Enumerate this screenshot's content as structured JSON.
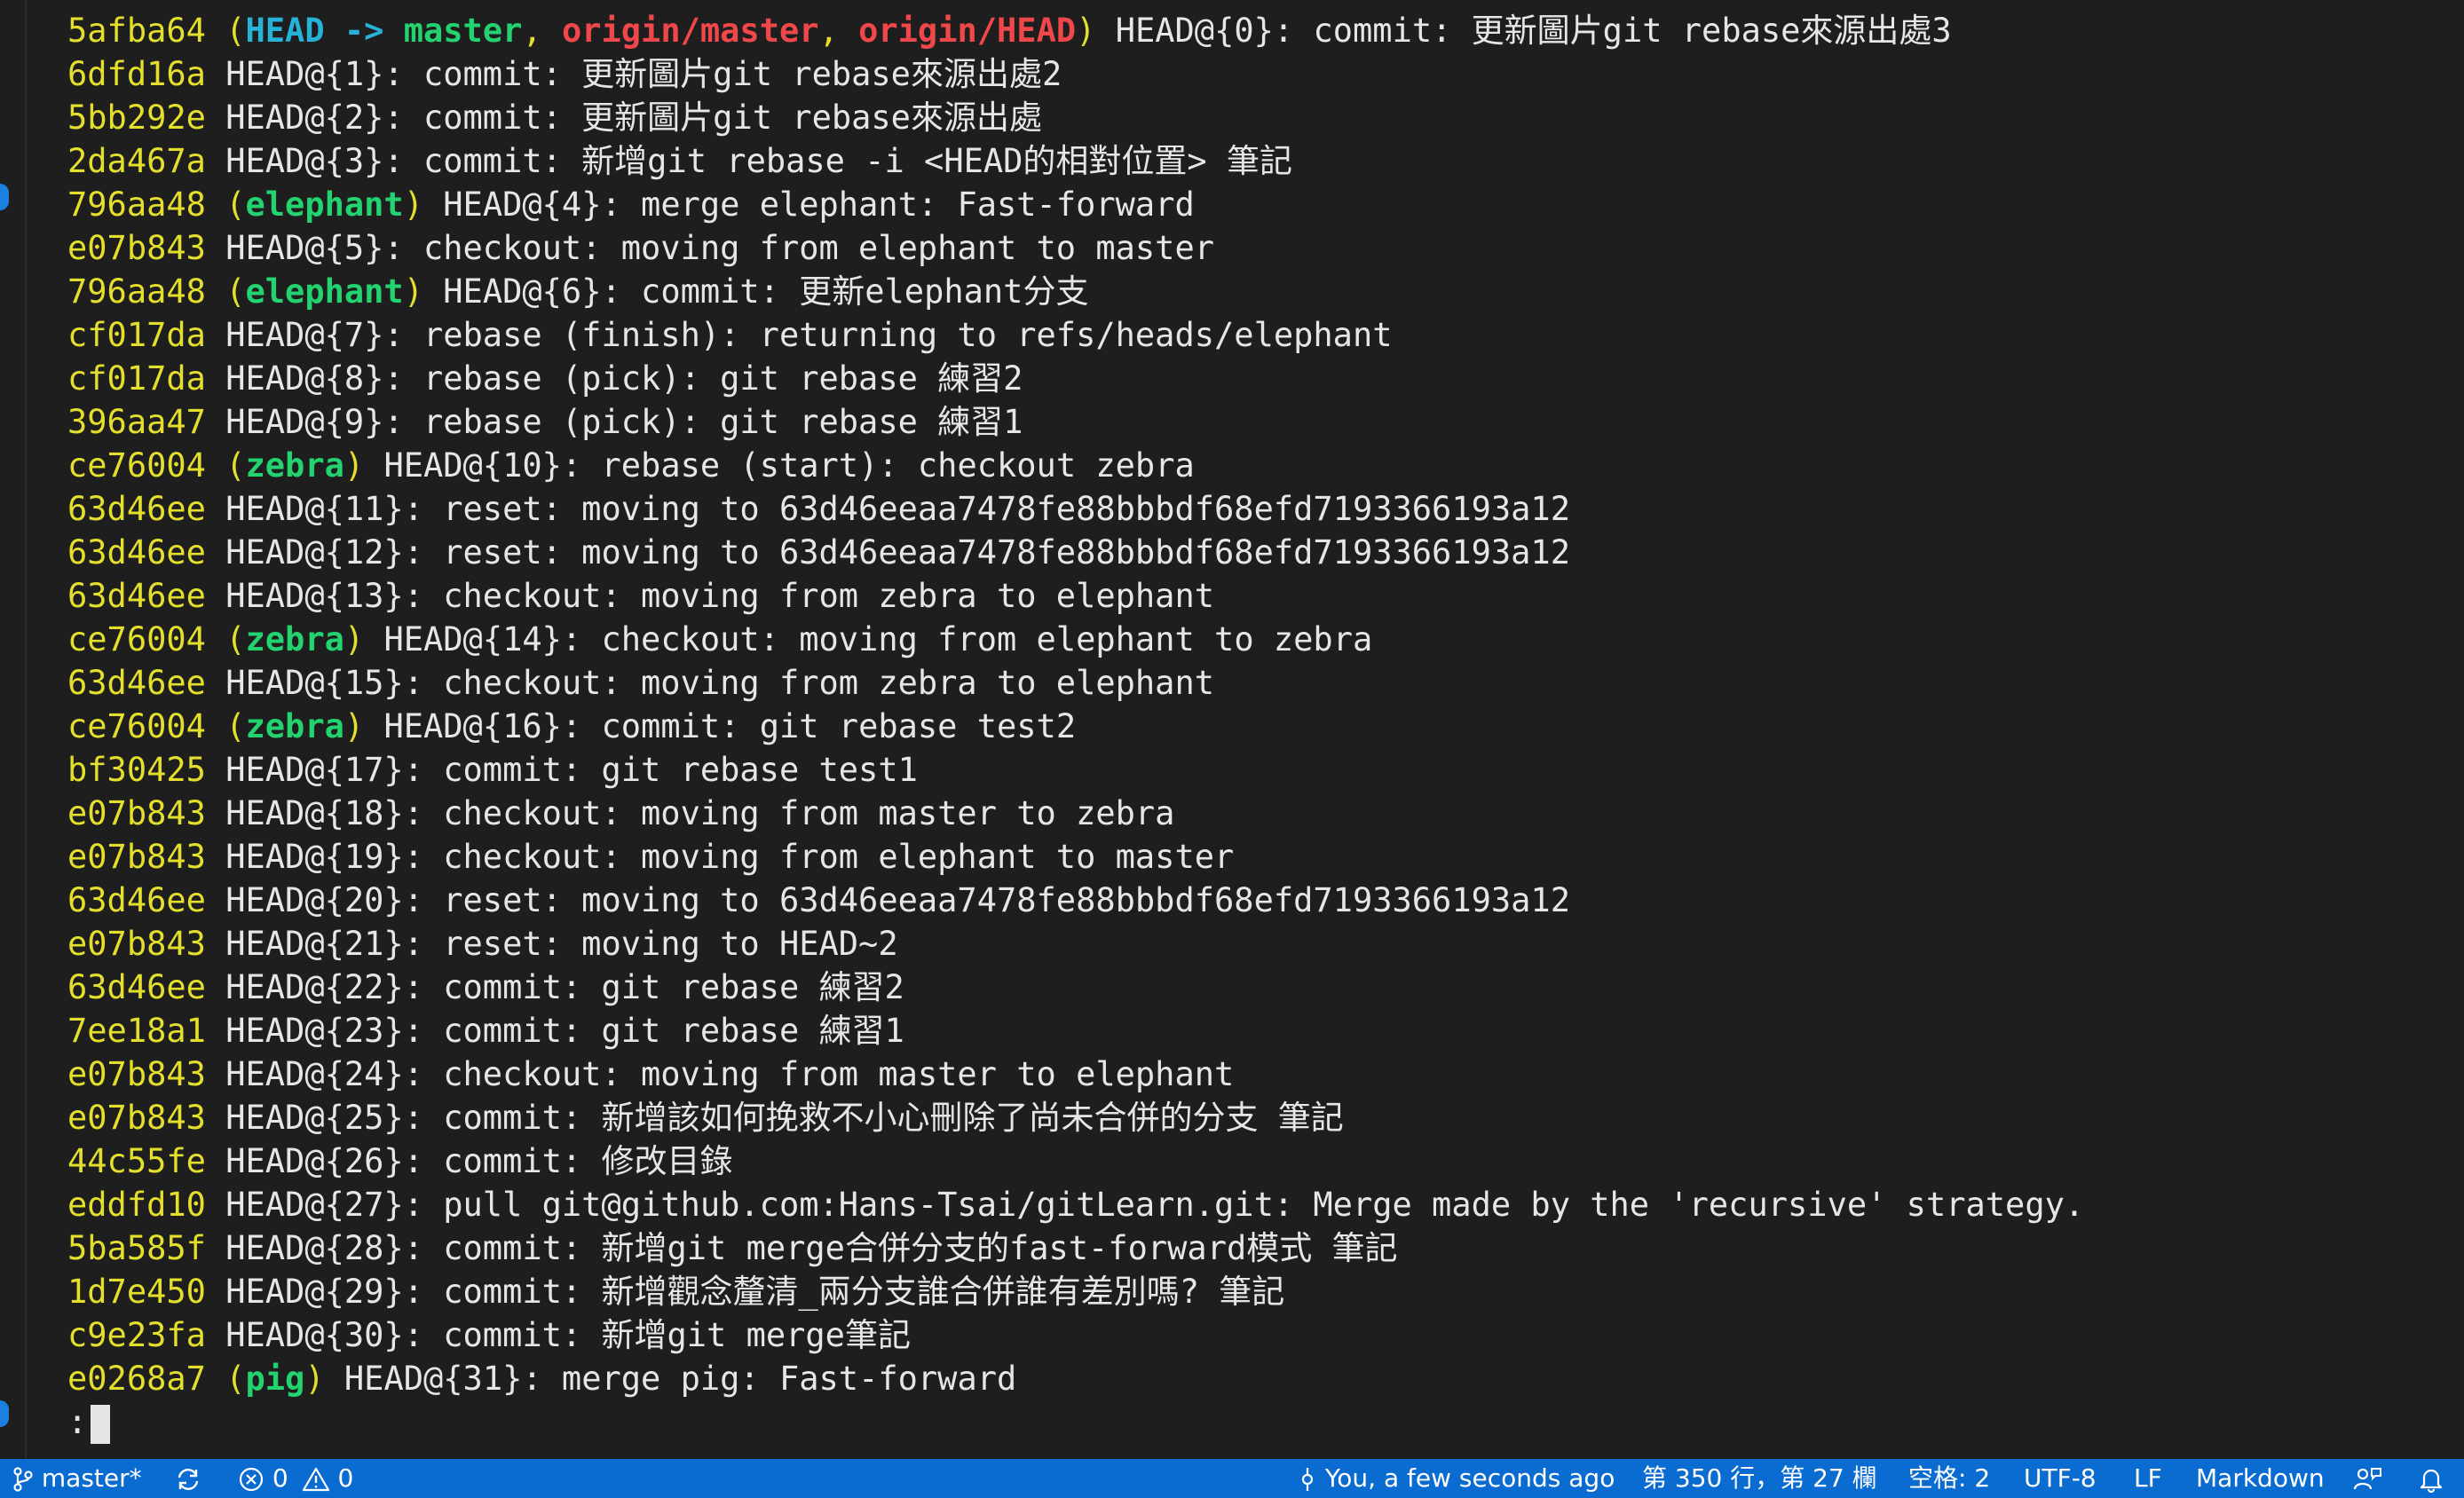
{
  "colors": {
    "background": "#1e1e1e",
    "hash": "#e3df2c",
    "head_ref": "#27b2d8",
    "local_branch": "#22d36f",
    "remote_branch": "#f0474a",
    "statusbar": "#0a6bd0"
  },
  "terminal": {
    "lines": [
      {
        "hash": "5afba64",
        "refs": [
          {
            "text": "HEAD -> ",
            "kind": "head"
          },
          {
            "text": "master",
            "kind": "local"
          },
          {
            "text": ", ",
            "kind": "paren"
          },
          {
            "text": "origin/master",
            "kind": "remote"
          },
          {
            "text": ", ",
            "kind": "paren"
          },
          {
            "text": "origin/HEAD",
            "kind": "remote"
          }
        ],
        "text": "HEAD@{0}: commit: 更新圖片git rebase來源出處3"
      },
      {
        "hash": "6dfd16a",
        "refs": [],
        "text": "HEAD@{1}: commit: 更新圖片git rebase來源出處2"
      },
      {
        "hash": "5bb292e",
        "refs": [],
        "text": "HEAD@{2}: commit: 更新圖片git rebase來源出處"
      },
      {
        "hash": "2da467a",
        "refs": [],
        "text": "HEAD@{3}: commit: 新增git rebase -i <HEAD的相對位置> 筆記"
      },
      {
        "hash": "796aa48",
        "refs": [
          {
            "text": "elephant",
            "kind": "local"
          }
        ],
        "text": "HEAD@{4}: merge elephant: Fast-forward"
      },
      {
        "hash": "e07b843",
        "refs": [],
        "text": "HEAD@{5}: checkout: moving from elephant to master"
      },
      {
        "hash": "796aa48",
        "refs": [
          {
            "text": "elephant",
            "kind": "local"
          }
        ],
        "text": "HEAD@{6}: commit: 更新elephant分支"
      },
      {
        "hash": "cf017da",
        "refs": [],
        "text": "HEAD@{7}: rebase (finish): returning to refs/heads/elephant"
      },
      {
        "hash": "cf017da",
        "refs": [],
        "text": "HEAD@{8}: rebase (pick): git rebase 練習2"
      },
      {
        "hash": "396aa47",
        "refs": [],
        "text": "HEAD@{9}: rebase (pick): git rebase 練習1"
      },
      {
        "hash": "ce76004",
        "refs": [
          {
            "text": "zebra",
            "kind": "local"
          }
        ],
        "text": "HEAD@{10}: rebase (start): checkout zebra"
      },
      {
        "hash": "63d46ee",
        "refs": [],
        "text": "HEAD@{11}: reset: moving to 63d46eeaa7478fe88bbbdf68efd7193366193a12"
      },
      {
        "hash": "63d46ee",
        "refs": [],
        "text": "HEAD@{12}: reset: moving to 63d46eeaa7478fe88bbbdf68efd7193366193a12"
      },
      {
        "hash": "63d46ee",
        "refs": [],
        "text": "HEAD@{13}: checkout: moving from zebra to elephant"
      },
      {
        "hash": "ce76004",
        "refs": [
          {
            "text": "zebra",
            "kind": "local"
          }
        ],
        "text": "HEAD@{14}: checkout: moving from elephant to zebra"
      },
      {
        "hash": "63d46ee",
        "refs": [],
        "text": "HEAD@{15}: checkout: moving from zebra to elephant"
      },
      {
        "hash": "ce76004",
        "refs": [
          {
            "text": "zebra",
            "kind": "local"
          }
        ],
        "text": "HEAD@{16}: commit: git rebase test2"
      },
      {
        "hash": "bf30425",
        "refs": [],
        "text": "HEAD@{17}: commit: git rebase test1"
      },
      {
        "hash": "e07b843",
        "refs": [],
        "text": "HEAD@{18}: checkout: moving from master to zebra"
      },
      {
        "hash": "e07b843",
        "refs": [],
        "text": "HEAD@{19}: checkout: moving from elephant to master"
      },
      {
        "hash": "63d46ee",
        "refs": [],
        "text": "HEAD@{20}: reset: moving to 63d46eeaa7478fe88bbbdf68efd7193366193a12"
      },
      {
        "hash": "e07b843",
        "refs": [],
        "text": "HEAD@{21}: reset: moving to HEAD~2"
      },
      {
        "hash": "63d46ee",
        "refs": [],
        "text": "HEAD@{22}: commit: git rebase 練習2"
      },
      {
        "hash": "7ee18a1",
        "refs": [],
        "text": "HEAD@{23}: commit: git rebase 練習1"
      },
      {
        "hash": "e07b843",
        "refs": [],
        "text": "HEAD@{24}: checkout: moving from master to elephant"
      },
      {
        "hash": "e07b843",
        "refs": [],
        "text": "HEAD@{25}: commit: 新增該如何挽救不小心刪除了尚未合併的分支 筆記"
      },
      {
        "hash": "44c55fe",
        "refs": [],
        "text": "HEAD@{26}: commit: 修改目錄"
      },
      {
        "hash": "eddfd10",
        "refs": [],
        "text": "HEAD@{27}: pull git@github.com:Hans-Tsai/gitLearn.git: Merge made by the 'recursive' strategy."
      },
      {
        "hash": "5ba585f",
        "refs": [],
        "text": "HEAD@{28}: commit: 新增git merge合併分支的fast-forward模式 筆記"
      },
      {
        "hash": "1d7e450",
        "refs": [],
        "text": "HEAD@{29}: commit: 新增觀念釐清_兩分支誰合併誰有差別嗎? 筆記"
      },
      {
        "hash": "c9e23fa",
        "refs": [],
        "text": "HEAD@{30}: commit: 新增git merge筆記"
      },
      {
        "hash": "e0268a7",
        "refs": [
          {
            "text": "pig",
            "kind": "local"
          }
        ],
        "text": "HEAD@{31}: merge pig: Fast-forward"
      }
    ],
    "prompt": ":"
  },
  "statusbar": {
    "branch": "master*",
    "errors": "0",
    "warnings": "0",
    "blame": "You, a few seconds ago",
    "position": "第 350 行，第 27 欄",
    "indent": "空格: 2",
    "encoding": "UTF-8",
    "eol": "LF",
    "language": "Markdown"
  }
}
